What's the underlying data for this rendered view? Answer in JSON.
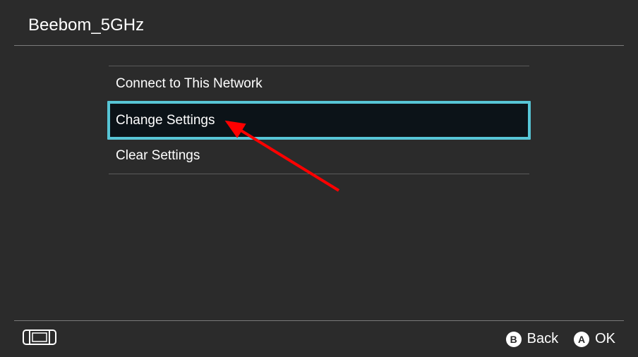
{
  "header": {
    "title": "Beebom_5GHz"
  },
  "menu": {
    "items": [
      {
        "label": "Connect to This Network",
        "selected": false
      },
      {
        "label": "Change Settings",
        "selected": true
      },
      {
        "label": "Clear Settings",
        "selected": false
      }
    ]
  },
  "footer": {
    "back": {
      "icon": "B",
      "label": "Back"
    },
    "ok": {
      "icon": "A",
      "label": "OK"
    }
  },
  "annotation": {
    "color": "#ff0000"
  }
}
